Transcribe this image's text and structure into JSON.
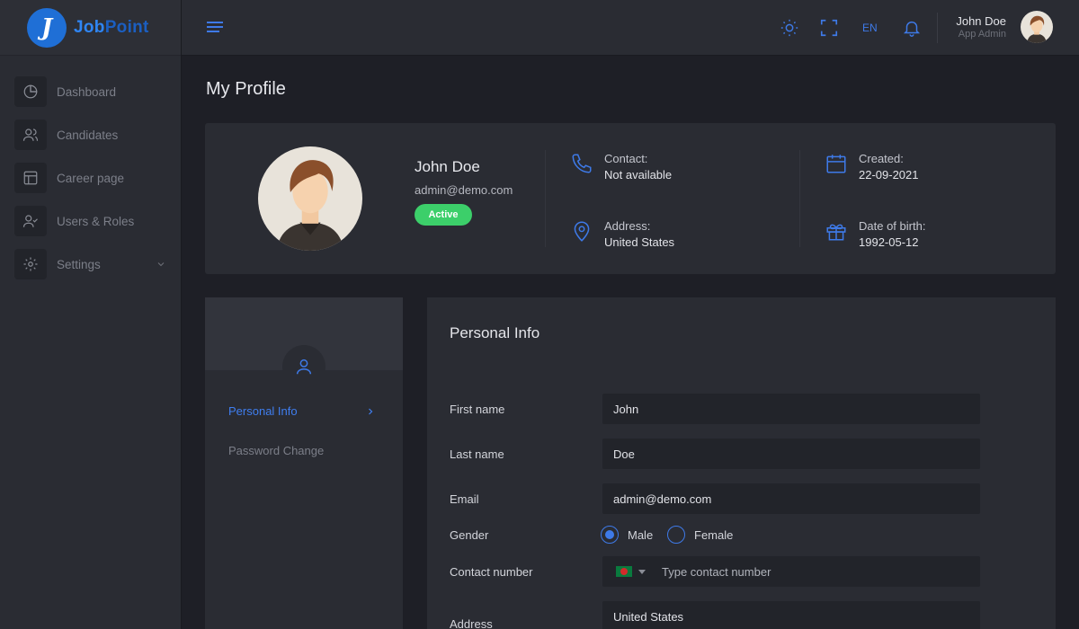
{
  "brand": {
    "logo_letter": "J",
    "name_part1": "Job",
    "name_part2": "Point"
  },
  "sidebar": {
    "items": [
      {
        "label": "Dashboard",
        "icon": "pie-chart-icon"
      },
      {
        "label": "Candidates",
        "icon": "users-icon"
      },
      {
        "label": "Career page",
        "icon": "layout-icon"
      },
      {
        "label": "Users & Roles",
        "icon": "user-check-icon"
      },
      {
        "label": "Settings",
        "icon": "gear-icon"
      }
    ]
  },
  "topbar": {
    "language": "EN",
    "user_name": "John Doe",
    "user_role": "App Admin"
  },
  "page": {
    "title": "My Profile"
  },
  "profile": {
    "name": "John Doe",
    "email": "admin@demo.com",
    "status": "Active",
    "contact_label": "Contact:",
    "contact_value": "Not available",
    "address_label": "Address:",
    "address_value": "United States",
    "created_label": "Created:",
    "created_value": "22-09-2021",
    "dob_label": "Date of birth:",
    "dob_value": "1992-05-12"
  },
  "tabs": {
    "personal_info": "Personal Info",
    "password_change": "Password Change"
  },
  "form": {
    "title": "Personal Info",
    "first_name_label": "First name",
    "first_name_value": "John",
    "last_name_label": "Last name",
    "last_name_value": "Doe",
    "email_label": "Email",
    "email_value": "admin@demo.com",
    "gender_label": "Gender",
    "gender_male": "Male",
    "gender_female": "Female",
    "contact_label": "Contact number",
    "contact_placeholder": "Type contact number",
    "address_label": "Address",
    "address_value": "United States"
  },
  "colors": {
    "accent": "#3e7ae8",
    "status_active": "#3ccf6a",
    "background": "#1e1f26",
    "card": "#2a2c33"
  }
}
